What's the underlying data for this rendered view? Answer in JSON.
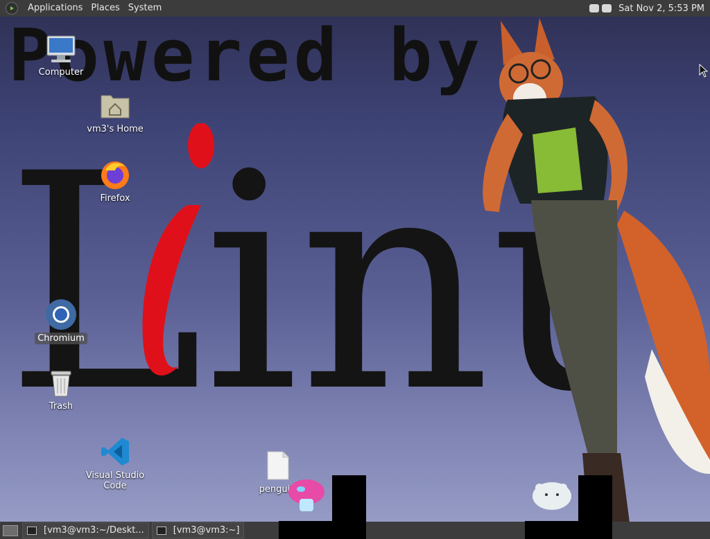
{
  "top_panel": {
    "menus": [
      "Applications",
      "Places",
      "System"
    ],
    "clock": "Sat Nov 2, 5:53 PM"
  },
  "wallpaper": {
    "powered_text": "Powered by",
    "linux_text": "Linux"
  },
  "desktop_icons": [
    {
      "label": "Computer",
      "icon": "computer-icon"
    },
    {
      "label": "vm3's Home",
      "icon": "home-folder-icon"
    },
    {
      "label": "Firefox",
      "icon": "firefox-icon"
    },
    {
      "label": "Chromium",
      "icon": "chromium-icon"
    },
    {
      "label": "Trash",
      "icon": "trash-icon"
    },
    {
      "label": "Visual Studio Code",
      "icon": "vscode-icon"
    },
    {
      "label": "penguin",
      "icon": "file-icon"
    }
  ],
  "taskbar": {
    "tasks": [
      "[vm3@vm3:~/Deskt...",
      "[vm3@vm3:~]"
    ]
  },
  "colors": {
    "panel": "#3c3c3c",
    "linux_red_i": "#e0101a"
  }
}
